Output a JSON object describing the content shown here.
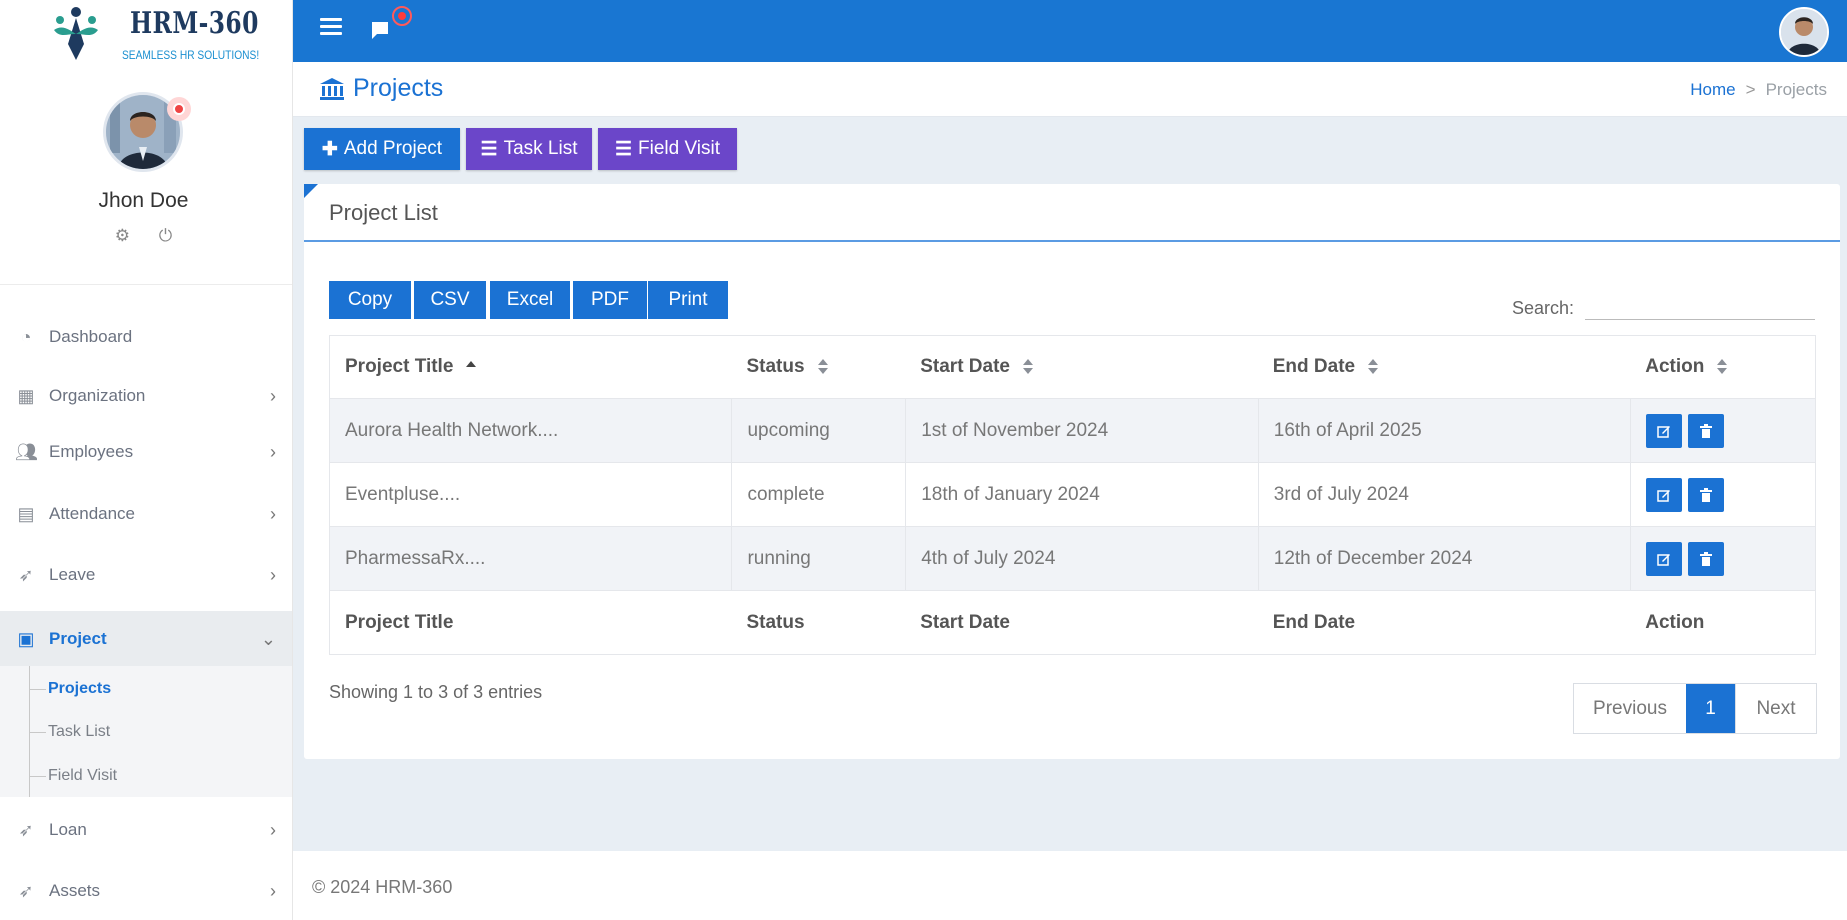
{
  "brand": {
    "title": "HRM-360",
    "tagline": "SEAMLESS HR SOLUTIONS!"
  },
  "profile": {
    "name": "Jhon Doe"
  },
  "sidebar": {
    "items": [
      {
        "label": "Dashboard",
        "icon": "gauge-icon"
      },
      {
        "label": "Organization",
        "icon": "building-icon"
      },
      {
        "label": "Employees",
        "icon": "users-icon"
      },
      {
        "label": "Attendance",
        "icon": "clipboard-icon"
      },
      {
        "label": "Leave",
        "icon": "rocket-icon"
      },
      {
        "label": "Project",
        "icon": "briefcase-icon"
      },
      {
        "label": "Loan",
        "icon": "rocket-icon"
      },
      {
        "label": "Assets",
        "icon": "rocket-icon"
      }
    ],
    "project_sub": [
      "Projects",
      "Task List",
      "Field Visit"
    ]
  },
  "page": {
    "title": "Projects",
    "breadcrumb_home": "Home",
    "breadcrumb_sep": ">",
    "breadcrumb_current": "Projects"
  },
  "actions": {
    "add_project": "Add Project",
    "task_list": "Task List",
    "field_visit": "Field Visit"
  },
  "card": {
    "title": "Project List"
  },
  "export": [
    "Copy",
    "CSV",
    "Excel",
    "PDF",
    "Print"
  ],
  "search": {
    "label": "Search:",
    "value": ""
  },
  "table": {
    "columns": [
      "Project Title",
      "Status",
      "Start Date",
      "End Date",
      "Action"
    ],
    "rows": [
      [
        "Aurora Health Network....",
        "upcoming",
        "1st of November 2024",
        "16th of April 2025"
      ],
      [
        "Eventpluse....",
        "complete",
        "18th of January 2024",
        "3rd of July 2024"
      ],
      [
        "PharmessaRx....",
        "running",
        "4th of July 2024",
        "12th of December 2024"
      ]
    ]
  },
  "pagination": {
    "showing": "Showing 1 to 3 of 3 entries",
    "previous": "Previous",
    "current": "1",
    "next": "Next"
  },
  "footer": {
    "text": "© 2024 HRM-360"
  },
  "colors": {
    "primary": "#1976d2",
    "accent_purple": "#6b46c9",
    "alert": "#ef4444"
  }
}
